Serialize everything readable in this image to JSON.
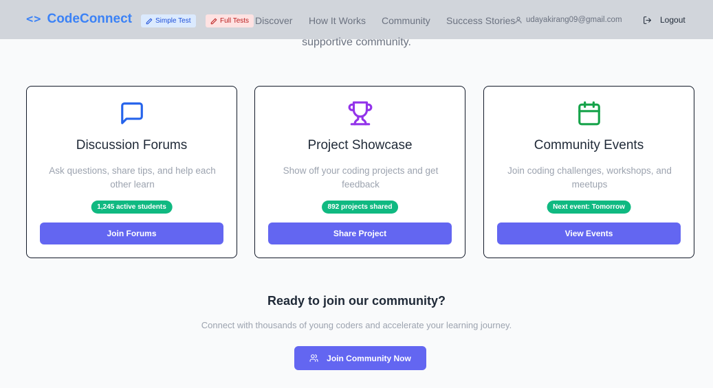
{
  "header": {
    "logo_icon": "<>",
    "logo_text": "CodeConnect",
    "chip_simple": "Simple Test",
    "chip_full": "Full Tests",
    "nav": [
      "Discover",
      "How It Works",
      "Community",
      "Success Stories"
    ],
    "user_email": "udayakirang09@gmail.com",
    "logout_label": "Logout"
  },
  "intro_fragment": "supportive community.",
  "cards": [
    {
      "icon": "message-square-icon",
      "title": "Discussion Forums",
      "description": "Ask questions, share tips, and help each other learn",
      "badge": "1,245 active students",
      "button": "Join Forums"
    },
    {
      "icon": "trophy-icon",
      "title": "Project Showcase",
      "description": "Show off your coding projects and get feedback",
      "badge": "892 projects shared",
      "button": "Share Project"
    },
    {
      "icon": "calendar-icon",
      "title": "Community Events",
      "description": "Join coding challenges, workshops, and meetups",
      "badge": "Next event: Tomorrow",
      "button": "View Events"
    }
  ],
  "cta": {
    "title": "Ready to join our community?",
    "subtitle": "Connect with thousands of young coders and accelerate your learning journey.",
    "button": "Join Community Now"
  },
  "colors": {
    "brand": "#3b82f6",
    "primary_button": "#6366f1",
    "badge": "#10b981",
    "forum_icon": "#2563eb",
    "trophy_icon": "#9333ea",
    "calendar_icon": "#16a34a"
  }
}
